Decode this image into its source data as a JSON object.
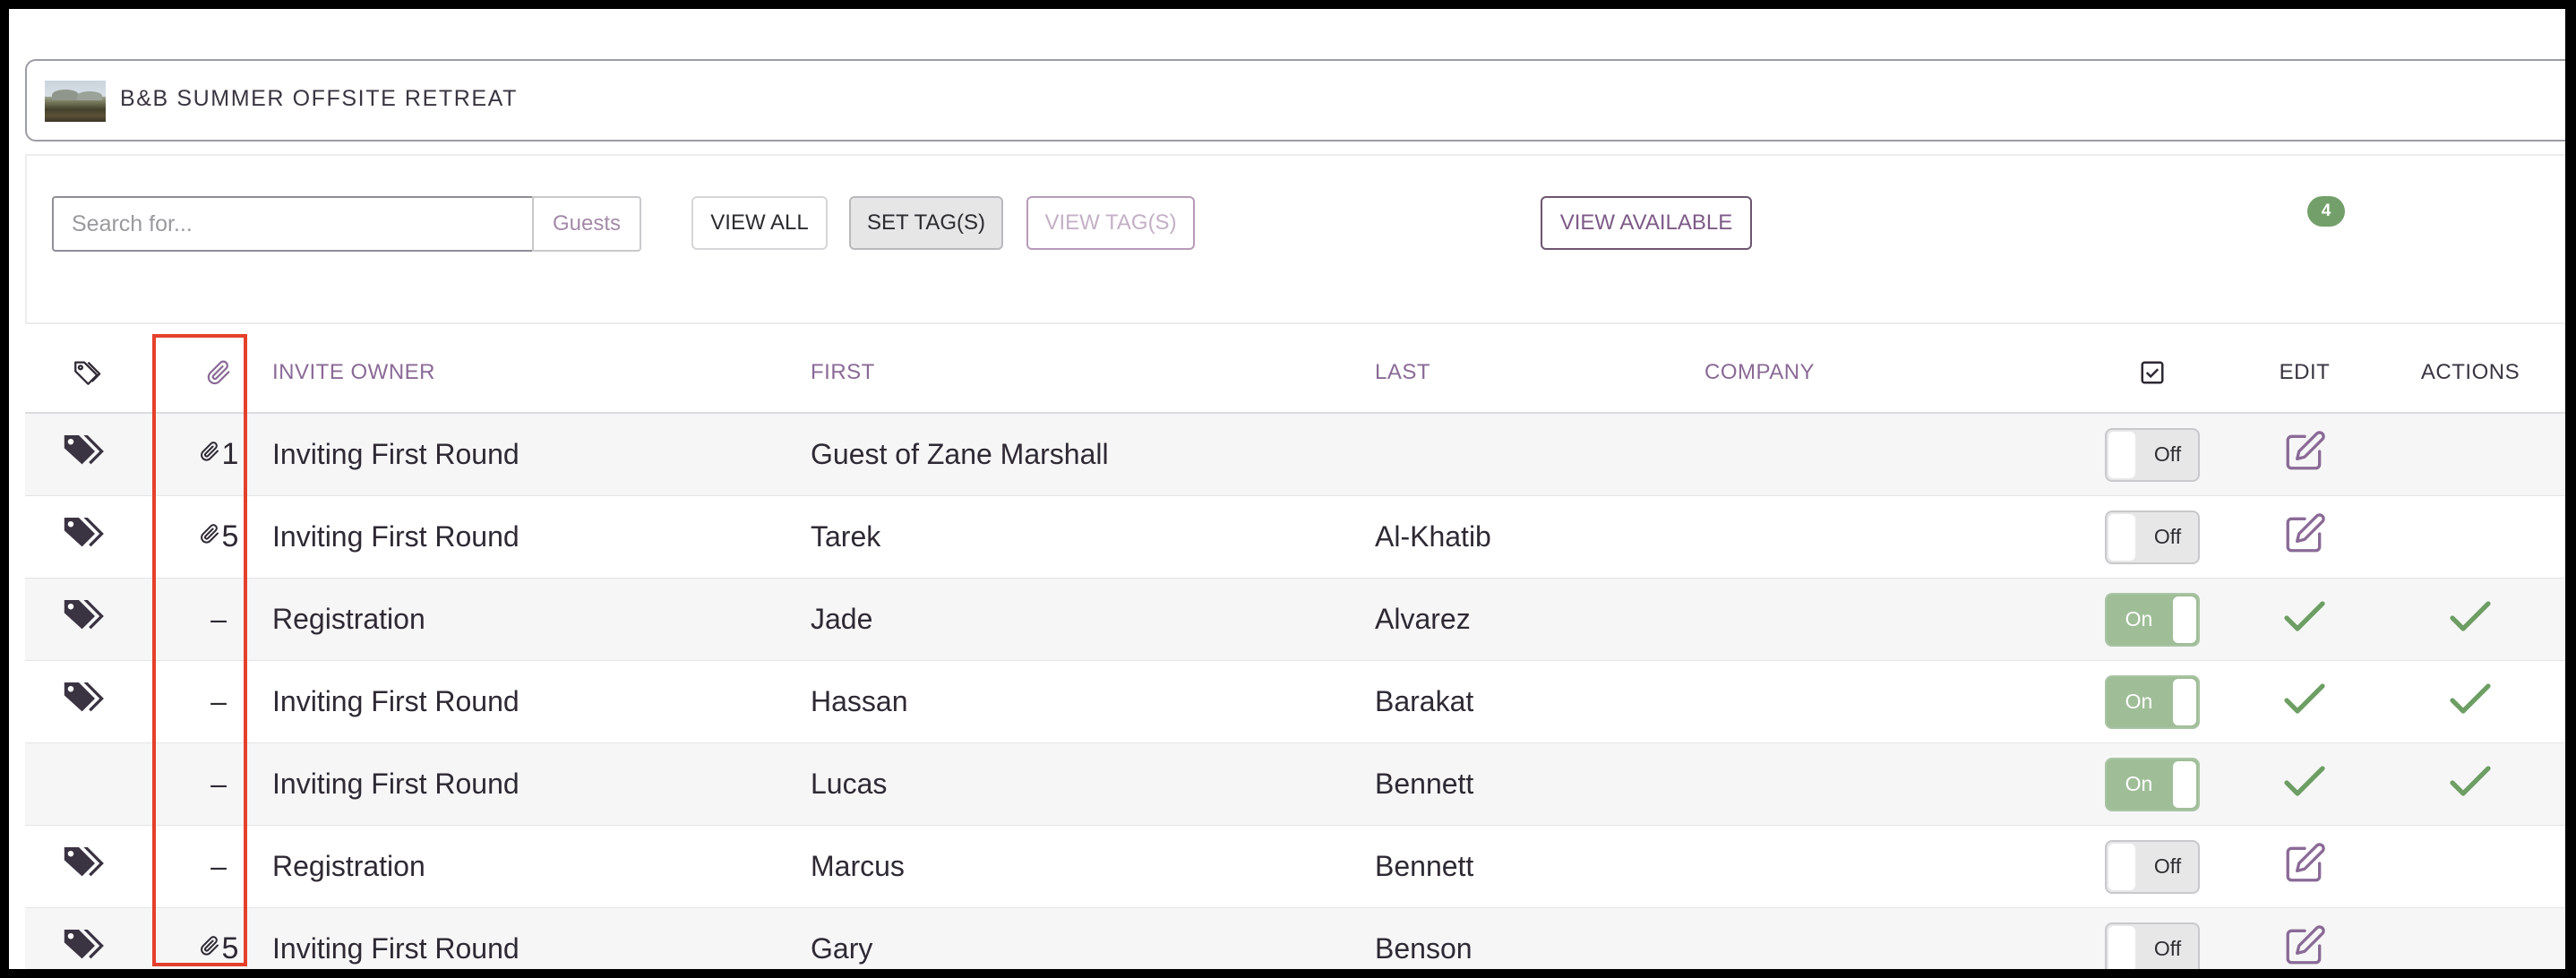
{
  "event": {
    "title": "B&B SUMMER OFFSITE RETREAT",
    "thumbnail": "event-photo"
  },
  "toolbar": {
    "search_placeholder": "Search for...",
    "search_scope": "Guests",
    "view_all_label": "VIEW ALL",
    "set_tags_label": "SET TAG(S)",
    "view_tags_label": "VIEW TAG(S)",
    "view_available_label": "VIEW AVAILABLE",
    "badge_count": "4"
  },
  "table": {
    "headers": {
      "tag": "tag-outline-icon",
      "attachment": "paperclip-icon",
      "invite_owner": "INVITE OWNER",
      "first": "FIRST",
      "last": "LAST",
      "company": "COMPANY",
      "check": "checkbox-icon",
      "edit": "EDIT",
      "actions": "ACTIONS"
    },
    "rows": [
      {
        "tagged": true,
        "attachments": "1",
        "invite_owner": "Inviting First Round",
        "first": "Guest of Zane Marshall",
        "last": "",
        "company": "",
        "toggle": "Off",
        "edit": "edit-icon",
        "action": ""
      },
      {
        "tagged": true,
        "attachments": "5",
        "invite_owner": "Inviting First Round",
        "first": "Tarek",
        "last": "Al-Khatib",
        "company": "",
        "toggle": "Off",
        "edit": "edit-icon",
        "action": ""
      },
      {
        "tagged": true,
        "attachments": "–",
        "invite_owner": "Registration",
        "first": "Jade",
        "last": "Alvarez",
        "company": "",
        "toggle": "On",
        "edit": "check-icon",
        "action": "check-icon"
      },
      {
        "tagged": true,
        "attachments": "–",
        "invite_owner": "Inviting First Round",
        "first": "Hassan",
        "last": "Barakat",
        "company": "",
        "toggle": "On",
        "edit": "check-icon",
        "action": "check-icon"
      },
      {
        "tagged": false,
        "attachments": "–",
        "invite_owner": "Inviting First Round",
        "first": "Lucas",
        "last": "Bennett",
        "company": "",
        "toggle": "On",
        "edit": "check-icon",
        "action": "check-icon"
      },
      {
        "tagged": true,
        "attachments": "–",
        "invite_owner": "Registration",
        "first": "Marcus",
        "last": "Bennett",
        "company": "",
        "toggle": "Off",
        "edit": "edit-icon",
        "action": ""
      },
      {
        "tagged": true,
        "attachments": "5",
        "invite_owner": "Inviting First Round",
        "first": "Gary",
        "last": "Benson",
        "company": "",
        "toggle": "Off",
        "edit": "edit-icon",
        "action": ""
      }
    ]
  },
  "colors": {
    "accent_purple": "#8a6a96",
    "icon_dark": "#3a3342",
    "success_green": "#6d9e63",
    "toggle_on": "#9fbe98",
    "highlight_red": "#e4412b"
  }
}
